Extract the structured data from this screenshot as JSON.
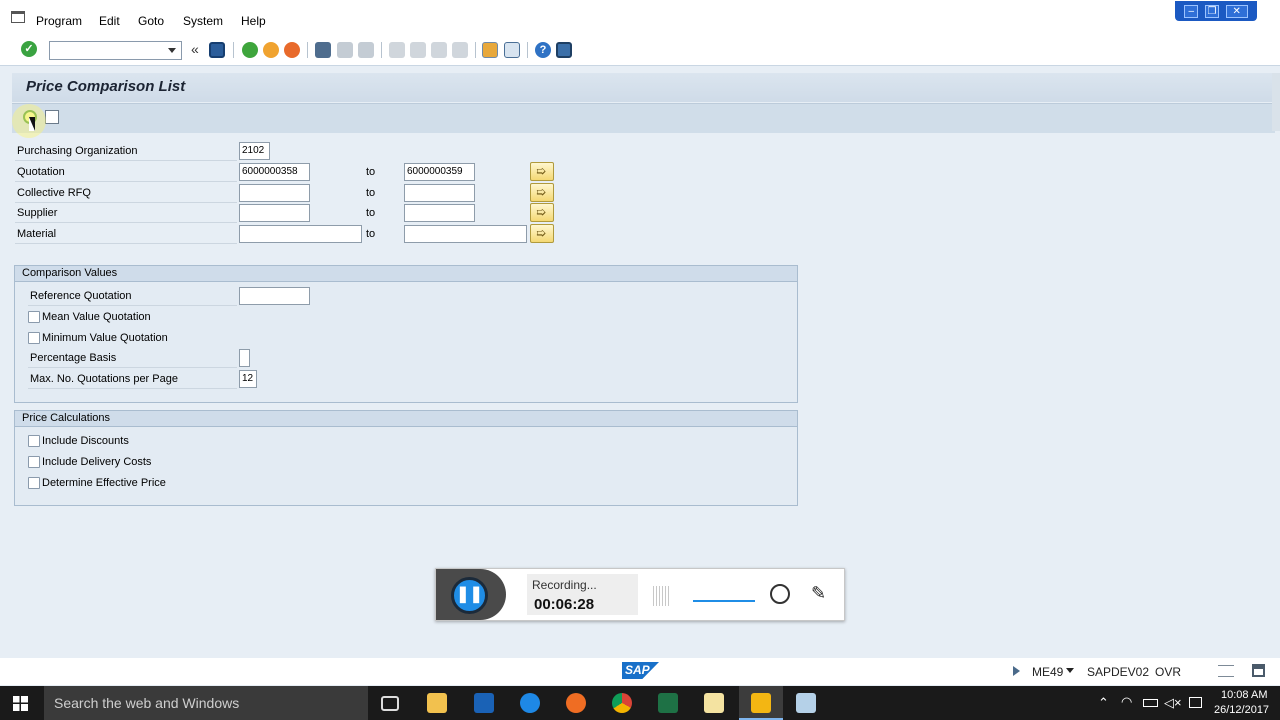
{
  "menu": {
    "items": [
      "Program",
      "Edit",
      "Goto",
      "System",
      "Help"
    ]
  },
  "window_controls": [
    "minimize",
    "restore",
    "close"
  ],
  "toolbar": {
    "command_value": "",
    "back_glyph": "«",
    "icons": [
      "check-icon",
      "save-icon",
      "back-icon",
      "exit-icon",
      "cancel-icon",
      "print-icon",
      "find-icon",
      "find-next-icon",
      "first-page-icon",
      "previous-page-icon",
      "next-page-icon",
      "last-page-icon",
      "create-session-icon",
      "shortcut-icon",
      "help-icon",
      "customize-layout-icon"
    ]
  },
  "screen": {
    "title": "Price Comparison List"
  },
  "selection": {
    "purchasing_org": {
      "label": "Purchasing Organization",
      "value": "2102"
    },
    "rows": [
      {
        "label": "Quotation",
        "from": "6000000358",
        "to_label": "to",
        "to": "6000000359"
      },
      {
        "label": "Collective RFQ",
        "from": "",
        "to_label": "to",
        "to": ""
      },
      {
        "label": "Supplier",
        "from": "",
        "to_label": "to",
        "to": ""
      },
      {
        "label": "Material",
        "from": "",
        "to_label": "to",
        "to": ""
      }
    ]
  },
  "comparison_values": {
    "header": "Comparison Values",
    "reference_quotation": {
      "label": "Reference Quotation",
      "value": ""
    },
    "mean_value": {
      "label": "Mean Value Quotation",
      "checked": false
    },
    "minimum_value": {
      "label": "Minimum Value Quotation",
      "checked": false
    },
    "percentage_basis": {
      "label": "Percentage Basis",
      "value": ""
    },
    "max_quotations": {
      "label": "Max. No. Quotations per Page",
      "value": "12"
    }
  },
  "price_calculations": {
    "header": "Price Calculations",
    "include_discounts": {
      "label": "Include Discounts",
      "checked": false
    },
    "include_delivery_costs": {
      "label": "Include Delivery Costs",
      "checked": false
    },
    "determine_effective_price": {
      "label": "Determine Effective Price",
      "checked": false
    }
  },
  "recorder": {
    "status": "Recording...",
    "time": "00:06:28",
    "pause_glyph": "❚❚"
  },
  "statusbar": {
    "logo": "SAP",
    "transaction": "ME49",
    "system": "SAPDEV02",
    "mode": "OVR"
  },
  "taskbar": {
    "search_placeholder": "Search the web and Windows",
    "apps": [
      "task-view-icon",
      "file-explorer-icon",
      "outlook-icon",
      "edge-icon",
      "firefox-icon",
      "chrome-icon",
      "excel-icon",
      "folder-icon",
      "sap-logon-icon",
      "sap-gui-icon"
    ],
    "time": "10:08 AM",
    "date": "26/12/2017"
  },
  "colors": {
    "title_bg": "#d6e1ec",
    "window_bg": "#e7eef5",
    "taskbar_bg": "#1a1a1a",
    "recorder_accent": "#1f8de6"
  }
}
